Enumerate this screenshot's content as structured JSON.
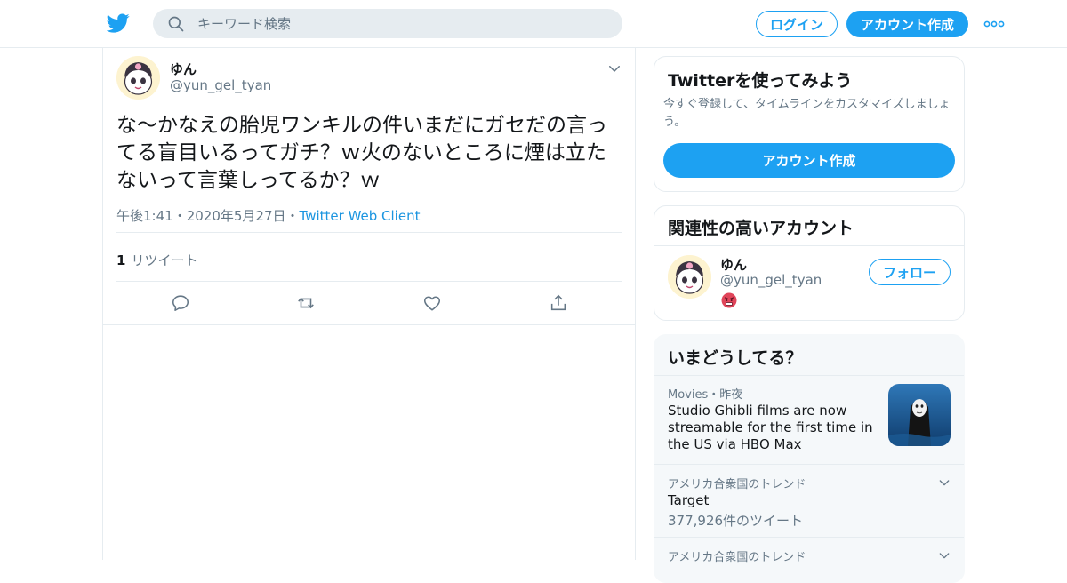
{
  "colors": {
    "brand": "#1da1f2",
    "text_secondary": "#657786",
    "link": "#1b95e0",
    "border": "#e6ecf0"
  },
  "header": {
    "logo_icon": "twitter-bird-icon",
    "search_placeholder": "キーワード検索",
    "login_label": "ログイン",
    "signup_label": "アカウント作成",
    "more_icon": "more-dots-icon"
  },
  "tweet": {
    "author_name": "ゆん",
    "author_handle": "@yun_gel_tyan",
    "text": "な～かなえの胎児ワンキルの件いまだにガセだの言ってる盲目いるってガチ？ｗ火のないところに煙は立たないって言葉しってるか？ｗ",
    "time": "午後1:41",
    "date": "2020年5月27日",
    "sep": "・",
    "source": "Twitter Web Client",
    "retweet_count": "1",
    "retweet_label": "リツイート",
    "actions": [
      "reply-icon",
      "retweet-icon",
      "like-icon",
      "share-icon"
    ]
  },
  "sidebar": {
    "try": {
      "title": "Twitterを使ってみよう",
      "description": "今すぐ登録して、タイムラインをカスタマイズしましょう。",
      "cta": "アカウント作成"
    },
    "related": {
      "title": "関連性の高いアカウント",
      "name": "ゆん",
      "handle": "@yun_gel_tyan",
      "follow_label": "フォロー"
    },
    "trends": {
      "title": "いまどうしてる？",
      "items": [
        {
          "category": "Movies",
          "time": "昨夜",
          "headline": "Studio Ghibli films are now streamable for the first time in the US via HBO Max"
        },
        {
          "context": "アメリカ合衆国のトレンド",
          "name": "Target",
          "count": "377,926件のツイート"
        },
        {
          "context": "アメリカ合衆国のトレンド"
        }
      ]
    }
  }
}
